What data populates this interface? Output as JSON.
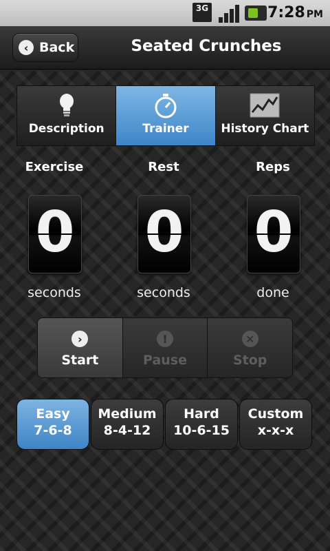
{
  "status_bar": {
    "network": "3G",
    "time": "7:28",
    "ampm": "PM"
  },
  "header": {
    "back_label": "Back",
    "title": "Seated Crunches"
  },
  "tabs": [
    {
      "label": "Description",
      "icon": "lightbulb-icon",
      "active": false
    },
    {
      "label": "Trainer",
      "icon": "stopwatch-icon",
      "active": true
    },
    {
      "label": "History Chart",
      "icon": "chart-icon",
      "active": false
    }
  ],
  "counters": [
    {
      "title": "Exercise",
      "value": "0",
      "unit": "seconds"
    },
    {
      "title": "Rest",
      "value": "0",
      "unit": "seconds"
    },
    {
      "title": "Reps",
      "value": "0",
      "unit": "done"
    }
  ],
  "controls": [
    {
      "label": "Start",
      "icon": "chevron-right-icon",
      "enabled": true
    },
    {
      "label": "Pause",
      "icon": "warning-icon",
      "enabled": false
    },
    {
      "label": "Stop",
      "icon": "close-icon",
      "enabled": false
    }
  ],
  "presets": [
    {
      "name": "Easy",
      "value": "7-6-8",
      "active": true
    },
    {
      "name": "Medium",
      "value": "8-4-12",
      "active": false
    },
    {
      "name": "Hard",
      "value": "10-6-15",
      "active": false
    },
    {
      "name": "Custom",
      "value": "x-x-x",
      "active": false
    }
  ],
  "colors": {
    "accent_blue": "#4a90d0",
    "dark_bg": "#262626"
  }
}
